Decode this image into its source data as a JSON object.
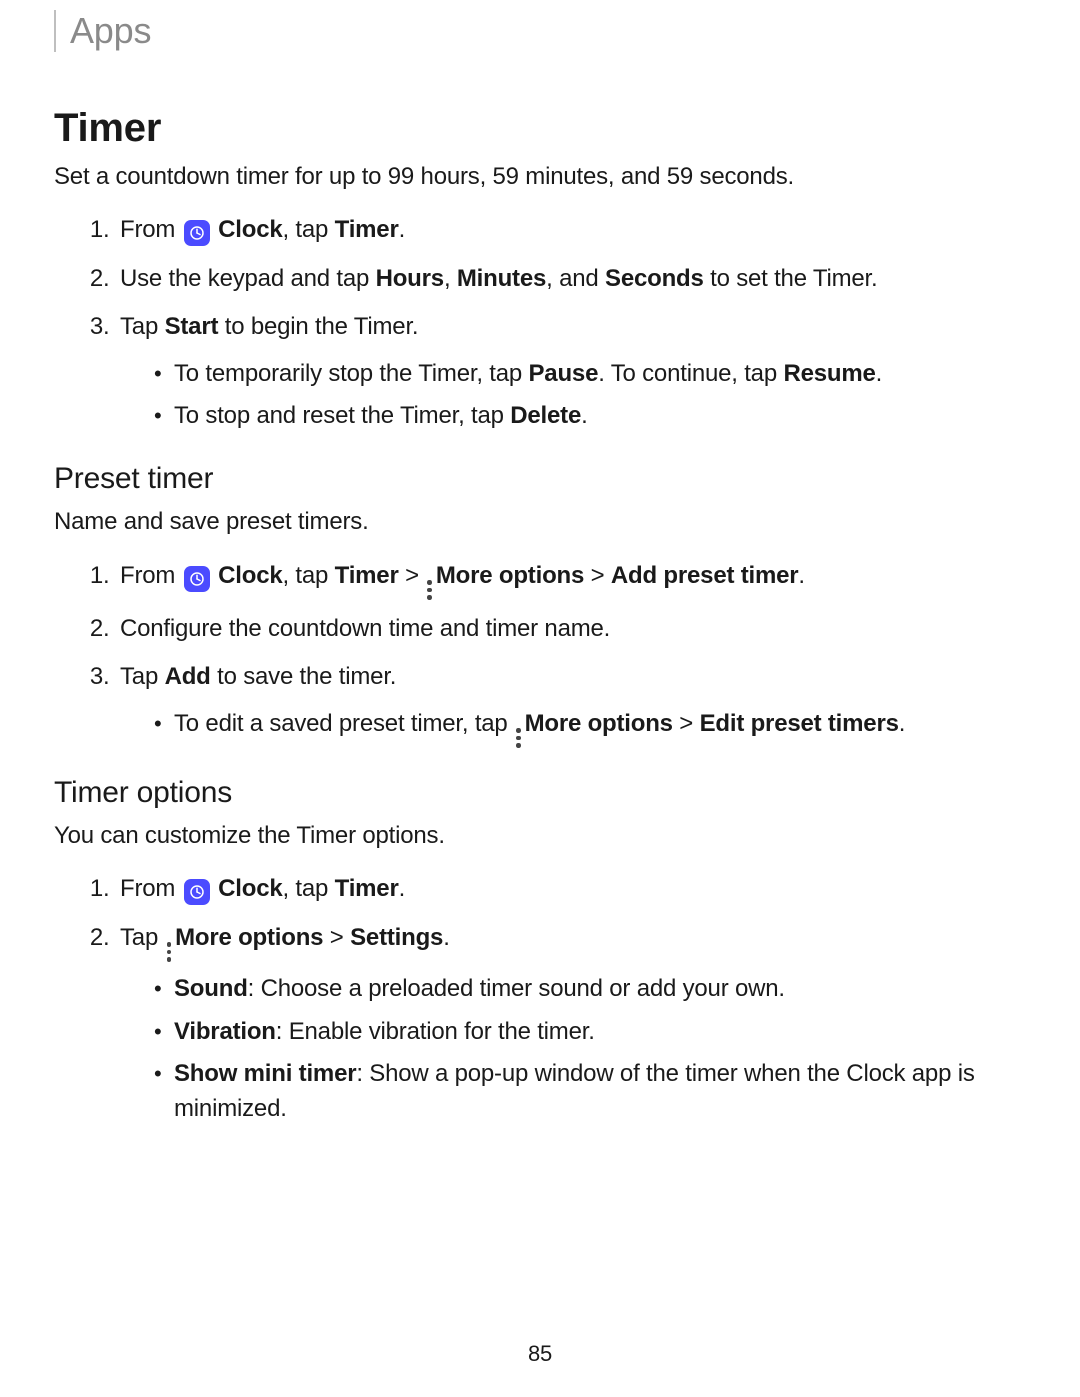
{
  "breadcrumb": "Apps",
  "page_number": "85",
  "timer": {
    "heading": "Timer",
    "intro": "Set a countdown timer for up to 99 hours, 59 minutes, and 59 seconds.",
    "step1_pre": "From ",
    "step1_clock": "Clock",
    "step1_post": ", tap ",
    "step1_timer": "Timer",
    "step1_end": ".",
    "step2_pre": "Use the keypad and tap ",
    "step2_hours": "Hours",
    "step2_c1": ", ",
    "step2_minutes": "Minutes",
    "step2_c2": ", and ",
    "step2_seconds": "Seconds",
    "step2_post": " to set the Timer.",
    "step3_pre": "Tap ",
    "step3_start": "Start",
    "step3_post": " to begin the Timer.",
    "sub1_pre": "To temporarily stop the Timer, tap ",
    "sub1_pause": "Pause",
    "sub1_mid": ". To continue, tap ",
    "sub1_resume": "Resume",
    "sub1_end": ".",
    "sub2_pre": "To stop and reset the Timer, tap ",
    "sub2_delete": "Delete",
    "sub2_end": "."
  },
  "preset": {
    "heading": "Preset timer",
    "intro": "Name and save preset timers.",
    "step1_pre": "From ",
    "step1_clock": "Clock",
    "step1_mid1": ", tap ",
    "step1_timer": "Timer",
    "step1_gt1": " > ",
    "step1_more": "More options",
    "step1_gt2": " > ",
    "step1_add": "Add preset timer",
    "step1_end": ".",
    "step2": "Configure the countdown time and timer name.",
    "step3_pre": "Tap ",
    "step3_add": "Add",
    "step3_post": " to save the timer.",
    "sub1_pre": "To edit a saved preset timer, tap ",
    "sub1_more": "More options",
    "sub1_gt": " > ",
    "sub1_edit": "Edit preset timers",
    "sub1_end": "."
  },
  "options": {
    "heading": "Timer options",
    "intro": "You can customize the Timer options.",
    "step1_pre": "From ",
    "step1_clock": "Clock",
    "step1_post": ", tap ",
    "step1_timer": "Timer",
    "step1_end": ".",
    "step2_pre": "Tap ",
    "step2_more": "More options",
    "step2_gt": " > ",
    "step2_settings": "Settings",
    "step2_end": ".",
    "sub1_label": "Sound",
    "sub1_text": ": Choose a preloaded timer sound or add your own.",
    "sub2_label": "Vibration",
    "sub2_text": ": Enable vibration for the timer.",
    "sub3_label": "Show mini timer",
    "sub3_text": ": Show a pop-up window of the timer when the Clock app is minimized."
  }
}
